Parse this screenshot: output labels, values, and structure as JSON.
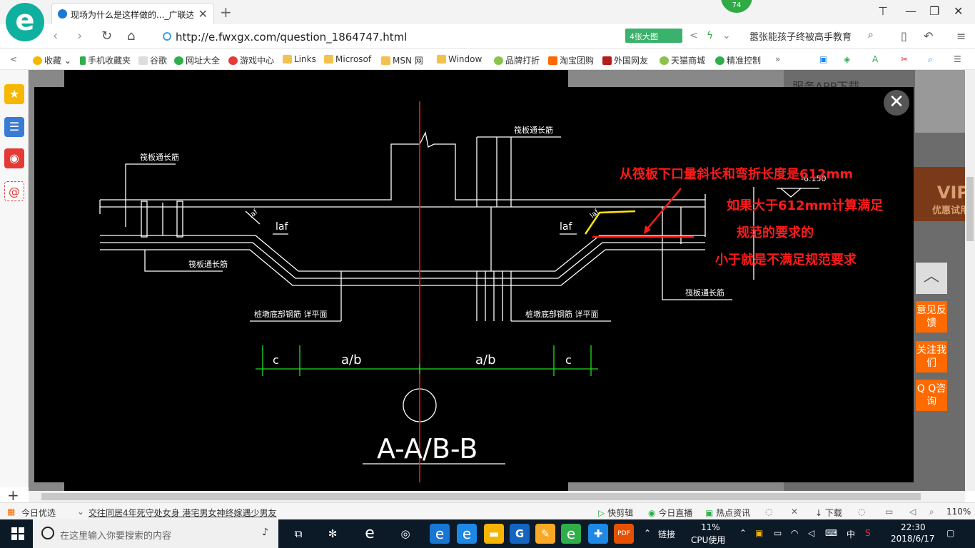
{
  "browser": {
    "logo_letter": "e",
    "tab_title": "现场为什么是这样做的..._广联达服务新干线",
    "tab_close": "✕",
    "new_tab": "+",
    "badge": "74",
    "window_controls": [
      "⊤",
      "—",
      "❐",
      "✕"
    ]
  },
  "addressbar": {
    "url": "http://e.fwxgx.com/question_1864747.html",
    "big_pic_label": "4张大图",
    "search_text": "嚣张能孩子终被高手教育",
    "nav_back": "‹",
    "nav_forward": "›",
    "reload": "↻",
    "home": "⌂"
  },
  "bookmarks": {
    "collapse": "<",
    "items": [
      {
        "label": "收藏",
        "color": "#f5b700"
      },
      {
        "label": "手机收藏夹",
        "color": "#2fae4a"
      },
      {
        "label": "谷歌",
        "color": "#bbbbbb"
      },
      {
        "label": "网址大全",
        "color": "#2fae4a"
      },
      {
        "label": "游戏中心",
        "color": "#e53935"
      },
      {
        "label": "Links",
        "color": "#f2c14e"
      },
      {
        "label": "Microsof",
        "color": "#f2c14e"
      },
      {
        "label": "MSN 网",
        "color": "#f2c14e"
      },
      {
        "label": "Window",
        "color": "#f2c14e"
      },
      {
        "label": "品牌打折",
        "color": "#8bc34a"
      },
      {
        "label": "淘宝团购",
        "color": "#ff6a00"
      },
      {
        "label": "外国网友",
        "color": "#b71c1c"
      },
      {
        "label": "天猫商城",
        "color": "#8bc34a"
      },
      {
        "label": "精准控制",
        "color": "#2fae4a"
      }
    ],
    "more": "»"
  },
  "sidebar": {
    "items": [
      {
        "name": "star-icon",
        "glyph": "★",
        "color": "#f5b700"
      },
      {
        "name": "list-icon",
        "glyph": "☰",
        "color": "#3a7bd5"
      },
      {
        "name": "weibo-icon",
        "glyph": "◉",
        "color": "#e53935"
      },
      {
        "name": "mail-icon",
        "glyph": "@",
        "color": "#e53935"
      }
    ],
    "add": "+"
  },
  "page": {
    "app_download": "服务APP下载",
    "vip": "VIP",
    "vip_trial": "优惠试用",
    "feedback": "意见反馈",
    "follow": "关注我们",
    "qq": "Q Q咨询",
    "to_top": "︿",
    "close": "✕"
  },
  "drawing": {
    "labels": {
      "top_left_bar": "筏板通长筋",
      "top_right_bar": "筏板通长筋",
      "mid_left_bar": "筏板通长筋",
      "right_bar": "筏板通长筋",
      "pile_left": "桩墩底部钢筋 详平面",
      "pile_right": "桩墩底部钢筋 详平面",
      "laf_left": "laf",
      "laf_right": "laf",
      "laf_slant_left": "laf",
      "laf_slant_right": "laf",
      "elev": "-6.150",
      "dim_c_left": "c",
      "dim_ab_left": "a/b",
      "dim_ab_right": "a/b",
      "dim_c_right": "c",
      "section": "A-A/B-B"
    }
  },
  "annotations": {
    "line1": "从筏板下口量斜长和弯折长度是612mm",
    "line2": "如果大于612mm计算满足",
    "line3": "规范的要求的",
    "line4": "小于就是不满足规范要求"
  },
  "statusbar": {
    "left1": "今日优选",
    "news": "交往同居4年死守处女身 港宅男女神终嫁遇少男友",
    "items": [
      "快剪辑",
      "今日直播",
      "热点资讯"
    ],
    "download": "下载",
    "zoom": "110%"
  },
  "taskbar": {
    "search_placeholder": "在这里输入你要搜索的内容",
    "link_label": "链接",
    "cpu_percent": "11%",
    "cpu_label": "CPU使用",
    "ime": "中",
    "time": "22:30",
    "date": "2018/6/17",
    "apps": [
      {
        "name": "task-view-icon",
        "glyph": "⧉",
        "color": "#0c1a28"
      },
      {
        "name": "fan-app-icon",
        "glyph": "✻",
        "color": "#0c1a28"
      },
      {
        "name": "edge-e-icon",
        "glyph": "e",
        "color": "#0c1a28"
      },
      {
        "name": "spiral-app-icon",
        "glyph": "◎",
        "color": "#0c1a28"
      },
      {
        "name": "edge-icon",
        "glyph": "e",
        "color": "#1976d2"
      },
      {
        "name": "ie-icon",
        "glyph": "e",
        "color": "#1e88e5"
      },
      {
        "name": "folder-icon",
        "glyph": "▬",
        "color": "#f4b400"
      },
      {
        "name": "glodon-icon",
        "glyph": "G",
        "color": "#1565c0"
      },
      {
        "name": "notes-icon",
        "glyph": "✎",
        "color": "#f9a825"
      },
      {
        "name": "browser-e-icon",
        "glyph": "e",
        "color": "#2fae4a"
      },
      {
        "name": "plus-app-icon",
        "glyph": "✚",
        "color": "#1e88e5"
      },
      {
        "name": "pdf-icon",
        "glyph": "PDF",
        "color": "#e65100"
      }
    ]
  }
}
